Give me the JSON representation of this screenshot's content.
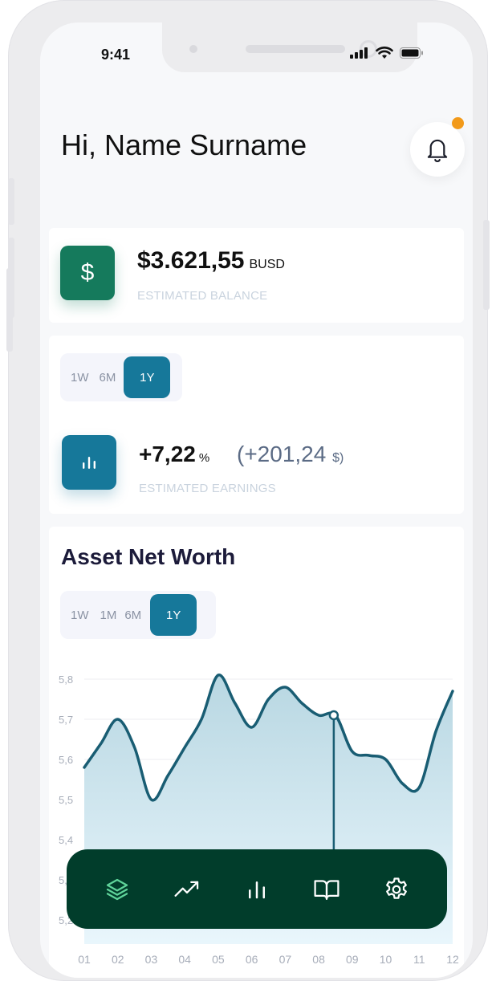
{
  "status_bar": {
    "time": "9:41"
  },
  "header": {
    "greeting": "Hi, Name Surname"
  },
  "balance_card": {
    "icon": "dollar-icon",
    "amount": "$3.621,55",
    "currency": "BUSD",
    "label": "ESTIMATED BALANCE"
  },
  "earnings_card": {
    "periods": [
      "1W",
      "6M",
      "1Y"
    ],
    "selected_period": "1Y",
    "percent": "+7,22",
    "percent_unit": "%",
    "amount": "(+201,24",
    "amount_unit": "$)",
    "label": "ESTIMATED EARNINGS"
  },
  "net_worth_card": {
    "title": "Asset Net Worth",
    "periods": [
      "1W",
      "1M",
      "6M",
      "1Y"
    ],
    "selected_period": "1Y"
  },
  "chart_data": {
    "type": "area",
    "title": "Asset Net Worth",
    "x": [
      "01",
      "02",
      "03",
      "04",
      "05",
      "06",
      "07",
      "08",
      "09",
      "10",
      "11",
      "12"
    ],
    "y_ticks": [
      "5,8",
      "5,7",
      "5,6",
      "5,5",
      "5,4",
      "5,3",
      "5,2"
    ],
    "ylim": [
      5.2,
      5.8
    ],
    "curve": [
      {
        "x": 1.0,
        "y": 5.58
      },
      {
        "x": 1.5,
        "y": 5.64
      },
      {
        "x": 2.0,
        "y": 5.7
      },
      {
        "x": 2.5,
        "y": 5.63
      },
      {
        "x": 3.0,
        "y": 5.5
      },
      {
        "x": 3.5,
        "y": 5.56
      },
      {
        "x": 4.0,
        "y": 5.63
      },
      {
        "x": 4.5,
        "y": 5.7
      },
      {
        "x": 5.0,
        "y": 5.81
      },
      {
        "x": 5.5,
        "y": 5.74
      },
      {
        "x": 6.0,
        "y": 5.68
      },
      {
        "x": 6.5,
        "y": 5.75
      },
      {
        "x": 7.0,
        "y": 5.78
      },
      {
        "x": 7.5,
        "y": 5.74
      },
      {
        "x": 8.0,
        "y": 5.71
      },
      {
        "x": 8.5,
        "y": 5.71
      },
      {
        "x": 9.0,
        "y": 5.62
      },
      {
        "x": 9.5,
        "y": 5.61
      },
      {
        "x": 10.0,
        "y": 5.6
      },
      {
        "x": 10.5,
        "y": 5.54
      },
      {
        "x": 11.0,
        "y": 5.53
      },
      {
        "x": 11.5,
        "y": 5.67
      },
      {
        "x": 12.0,
        "y": 5.77
      }
    ],
    "marker_x": 8.45,
    "grid": true,
    "colors": {
      "line": "#195d73",
      "fill_top": "#b8d7e2",
      "fill_bottom": "#e9f6fc",
      "grid": "#eceef2",
      "tick": "#a7adb9"
    }
  },
  "navbar": {
    "items": [
      {
        "icon": "layers-icon",
        "active": true
      },
      {
        "icon": "trending-icon",
        "active": false
      },
      {
        "icon": "bar-chart-icon",
        "active": false
      },
      {
        "icon": "book-icon",
        "active": false
      },
      {
        "icon": "settings-icon",
        "active": false
      }
    ],
    "colors": {
      "background": "#013d2b",
      "active": "#5fd39a",
      "inactive": "#ffffff"
    }
  }
}
